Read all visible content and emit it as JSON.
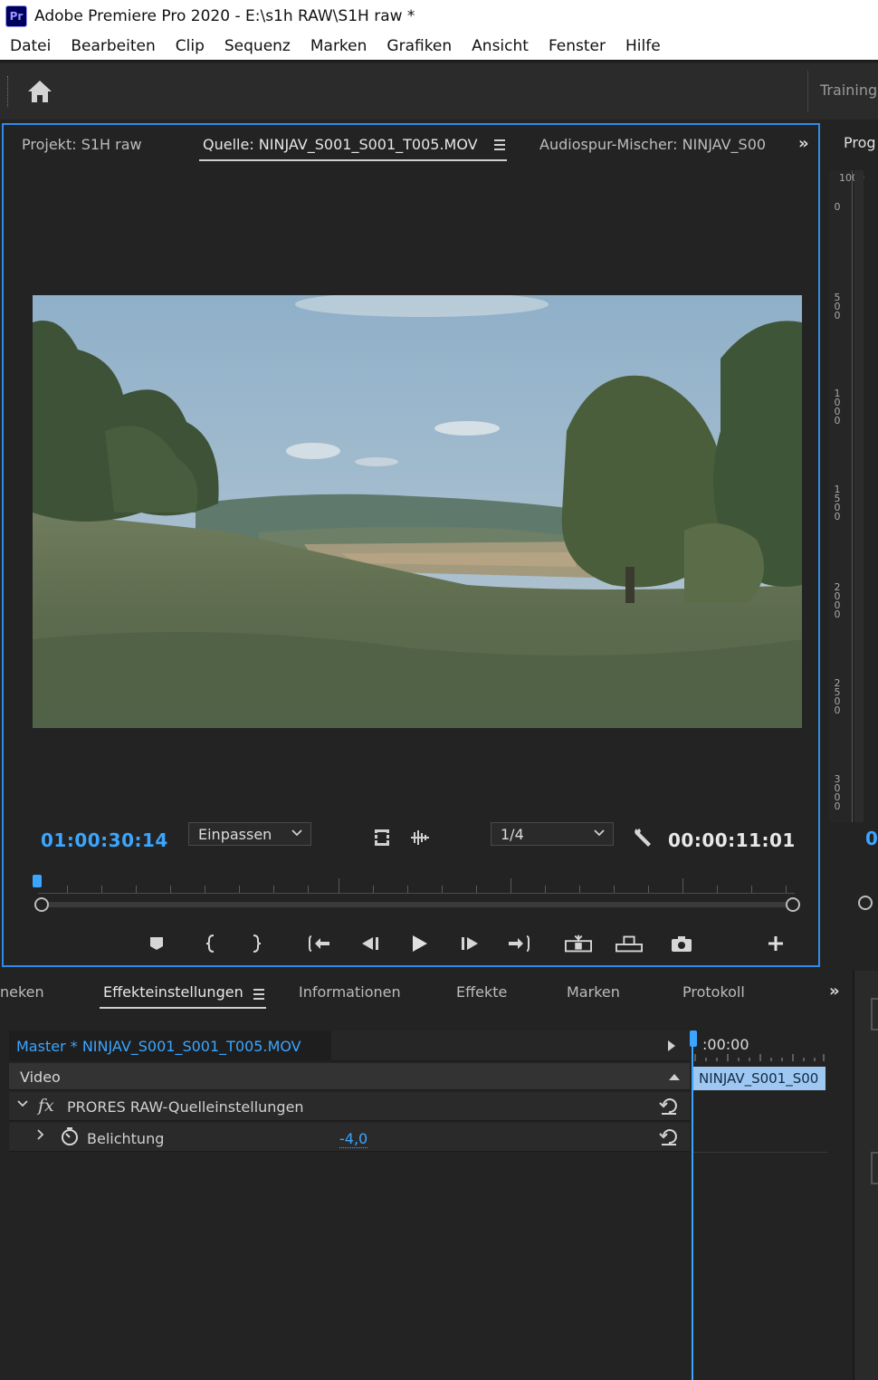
{
  "titlebar": {
    "logo": "Pr",
    "title": "Adobe Premiere Pro 2020 - E:\\s1h RAW\\S1H raw *"
  },
  "menu": [
    "Datei",
    "Bearbeiten",
    "Clip",
    "Sequenz",
    "Marken",
    "Grafiken",
    "Ansicht",
    "Fenster",
    "Hilfe"
  ],
  "workspace": {
    "home_icon": "home-icon",
    "label": "Training"
  },
  "source_panel": {
    "tabs": {
      "project": "Projekt: S1H raw",
      "source": "Quelle: NINJAV_S001_S001_T005.MOV",
      "mixer": "Audiospur-Mischer: NINJAV_S00"
    },
    "timecode_in": "01:00:30:14",
    "fit_dropdown": "Einpassen",
    "resolution_dropdown": "1/4",
    "timecode_duration": "00:00:11:01",
    "controls": [
      "add-marker",
      "mark-in",
      "mark-out",
      "go-to-in",
      "step-back",
      "play",
      "step-forward",
      "go-to-out",
      "insert",
      "overwrite",
      "export-frame",
      "add-button"
    ]
  },
  "program_panel": {
    "tab": "Prog",
    "ruler_top_label": "1000",
    "ruler_labels": [
      "0",
      "500",
      "1000",
      "1500",
      "2000",
      "2500",
      "3000"
    ],
    "timecode": "0"
  },
  "effects_panel": {
    "tabs": {
      "partial_left": "neken",
      "effect_controls": "Effekteinstellungen",
      "info": "Informationen",
      "effects": "Effekte",
      "markers": "Marken",
      "history": "Protokoll"
    },
    "master_label": "Master * NINJAV_S001_S001_T005.MOV",
    "video_section": "Video",
    "effect_name": "PRORES RAW-Quelleinstellungen",
    "fx_badge": "fx",
    "param_name": "Belichtung",
    "param_value": "-4,0",
    "timeline_time": ":00:00",
    "clip_name": "NINJAV_S001_S00"
  }
}
